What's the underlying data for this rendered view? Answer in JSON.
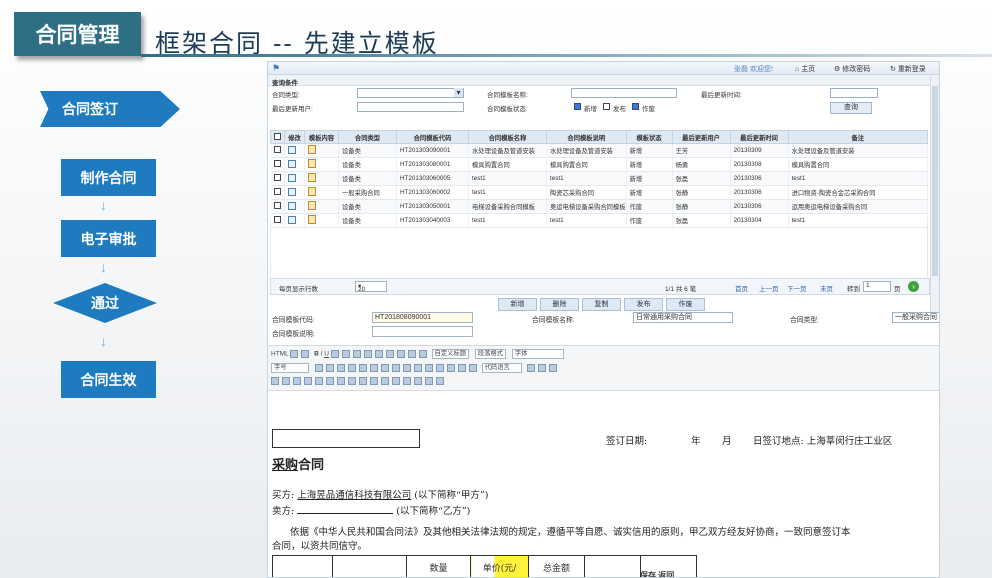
{
  "slide": {
    "badge": "合同管理",
    "title": "框架合同 -- 先建立模板"
  },
  "flow": {
    "steps": [
      "合同签订",
      "制作合同",
      "电子审批",
      "通过",
      "合同生效"
    ],
    "arrow_glyph": "↓"
  },
  "app": {
    "topbar": {
      "welcome": "张磊 欢迎您!",
      "home": "主页",
      "change_password": "修改密码",
      "relogin": "重新登录"
    },
    "query": {
      "section_title": "查询条件",
      "contract_type_label": "合同类型:",
      "template_name_label": "合同模板名称:",
      "last_update_time_label": "最后更新时间:",
      "last_update_user_label": "最后更新用户:",
      "template_status_label": "合同模板状态:",
      "status_options": [
        {
          "label": "新增",
          "checked": true
        },
        {
          "label": "发布",
          "checked": false
        },
        {
          "label": "作废",
          "checked": true
        }
      ],
      "query_button": "查询"
    },
    "table": {
      "headers": [
        "修改",
        "模板内容",
        "合同类型",
        "合同模板代码",
        "合同模板名称",
        "合同模板说明",
        "模板状态",
        "最后更新用户",
        "最后更新时间",
        "备注"
      ],
      "rows": [
        {
          "type": "设备类",
          "code": "HT201303090001",
          "name": "水处理设备及管道安装",
          "desc": "水处理设备及管道安装",
          "status": "新增",
          "user": "王芳",
          "time": "20130309",
          "note": "水处理设备及管道安装"
        },
        {
          "type": "设备类",
          "code": "HT201303080001",
          "name": "模具购置合同",
          "desc": "模具购置合同",
          "status": "新增",
          "user": "杨勇",
          "time": "20130308",
          "note": "模具购置合同"
        },
        {
          "type": "设备类",
          "code": "HT201303060005",
          "name": "test1",
          "desc": "test1",
          "status": "新增",
          "user": "张磊",
          "time": "20130306",
          "note": "test1"
        },
        {
          "type": "一般采购合同",
          "code": "HT201303060002",
          "name": "test1",
          "desc": "陶瓷芯采购合同",
          "status": "新增",
          "user": "张静",
          "time": "20130306",
          "note": "进口物资-陶瓷合金芯采购合同"
        },
        {
          "type": "设备类",
          "code": "HT201303050001",
          "name": "电梯设备采购合同模板",
          "desc": "奥运电梯设备采购合同模板",
          "status": "作废",
          "user": "张静",
          "time": "20130306",
          "note": "运用奥运电梯设备采购合同"
        },
        {
          "type": "设备类",
          "code": "HT201303040003",
          "name": "test1",
          "desc": "test1",
          "status": "作废",
          "user": "张磊",
          "time": "20130304",
          "note": "test1"
        }
      ]
    },
    "pager": {
      "page_size_label": "每页显示行数",
      "page_size": "20",
      "info": "1/1  共  6  笔",
      "first": "首页",
      "prev": "上一页",
      "next": "下一页",
      "last": "末页",
      "goto": "转到",
      "goto_value": "1",
      "page_unit": "页"
    },
    "actions": [
      "新增",
      "删除",
      "复制",
      "发布",
      "作废"
    ],
    "form": {
      "code_label": "合同模板代码:",
      "code_value": "HT201808090001",
      "name_label": "合同模板名称:",
      "name_value": "日常通用采购合同",
      "type_label": "合同类型:",
      "type_value": "一般采购合同",
      "desc_label": "合同模板说明:",
      "desc_value": ""
    },
    "editor": {
      "row1_left": "HTML",
      "custom_title": "自定义标题",
      "paragraph_format": "段落格式",
      "font": "字体",
      "font_size": "字号",
      "code_lang": "代码语言"
    },
    "document": {
      "sign_date": "签订日期:",
      "year": "年",
      "month": "月",
      "day_place": "日签订地点: 上海莘闵行庄工业区",
      "doc_title_a": "采购",
      "doc_title_b": "合同",
      "buyer_label": "买方:",
      "buyer_name": "上海昱品通信科技有限公司",
      "buyer_suffix": "(以下简称“甲方”)",
      "seller_label": "卖方:",
      "seller_suffix": "(以下简称“乙方”)",
      "para_line1": "依据《中华人民共和国合同法》及其他相关法律法规的规定，遵循平等自愿、诚实信用的原则，甲乙双方经友好协商，一致同意签订本",
      "para_line2": "合同，以资共同信守。",
      "table_headers": [
        "",
        "",
        "数量",
        "单价(元/",
        "总金额",
        "",
        ""
      ],
      "save": "保存",
      "back": "返回"
    }
  }
}
